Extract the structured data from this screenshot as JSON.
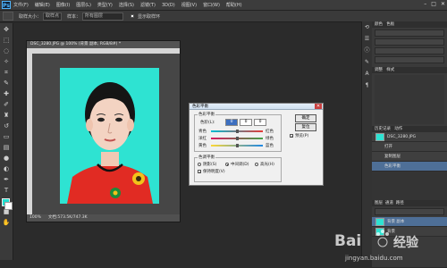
{
  "app": {
    "logo": "Ps"
  },
  "menu": [
    "文件(F)",
    "编辑(E)",
    "图像(I)",
    "图层(L)",
    "类型(Y)",
    "选择(S)",
    "滤镜(T)",
    "3D(D)",
    "视图(V)",
    "窗口(W)",
    "帮助(H)"
  ],
  "window_controls": [
    "–",
    "□",
    "✕"
  ],
  "options_bar": {
    "sample_size_label": "取样大小：",
    "sample_size_value": "取样点",
    "sample_label": "样本：",
    "sample_value": "所有图层",
    "show_ring_label": "显示取样环"
  },
  "document": {
    "tab_title": "DSC_3280.JPG @ 100% (背景 副本, RGB/8#) *",
    "zoom": "100%",
    "doc_info": "文档:573.5K/747.3K"
  },
  "dialog": {
    "title": "色彩平衡",
    "close": "✕",
    "group_balance": "色彩平衡",
    "levels_label": "色阶(L):",
    "levels": [
      "0",
      "0",
      "0"
    ],
    "sliders": [
      {
        "left": "青色",
        "right": "红色",
        "value": 0
      },
      {
        "left": "洋红",
        "right": "绿色",
        "value": 0
      },
      {
        "left": "黄色",
        "right": "蓝色",
        "value": 0
      }
    ],
    "group_tone": "色调平衡",
    "tones": [
      {
        "label": "阴影(S)",
        "checked": false
      },
      {
        "label": "中间调(D)",
        "checked": true
      },
      {
        "label": "高光(H)",
        "checked": false
      }
    ],
    "preserve_luminosity": "保持明度(V)",
    "ok": "确定",
    "cancel": "复位",
    "preview": "预览(P)"
  },
  "panels": {
    "color_tabs": [
      "颜色",
      "色板"
    ],
    "adjust_tabs": [
      "调整",
      "样式"
    ],
    "layer_tabs": [
      "图层",
      "通道",
      "路径"
    ],
    "history_tabs": [
      "历史记录",
      "动作"
    ],
    "history_file": "DSC_3280.JPG",
    "history_items": [
      "打开",
      "复制图层",
      "色彩平衡"
    ],
    "layers": [
      {
        "name": "背景 副本",
        "selected": true
      },
      {
        "name": "背景",
        "selected": false
      }
    ]
  },
  "watermark": {
    "brand": "Bai",
    "brand2": "经验",
    "url": "jingyan.baidu.com"
  },
  "colors": {
    "foreground": "#20e0d0",
    "background": "#ffffff",
    "photo_bg": "#2ee3d2",
    "shirt": "#e12b23"
  }
}
